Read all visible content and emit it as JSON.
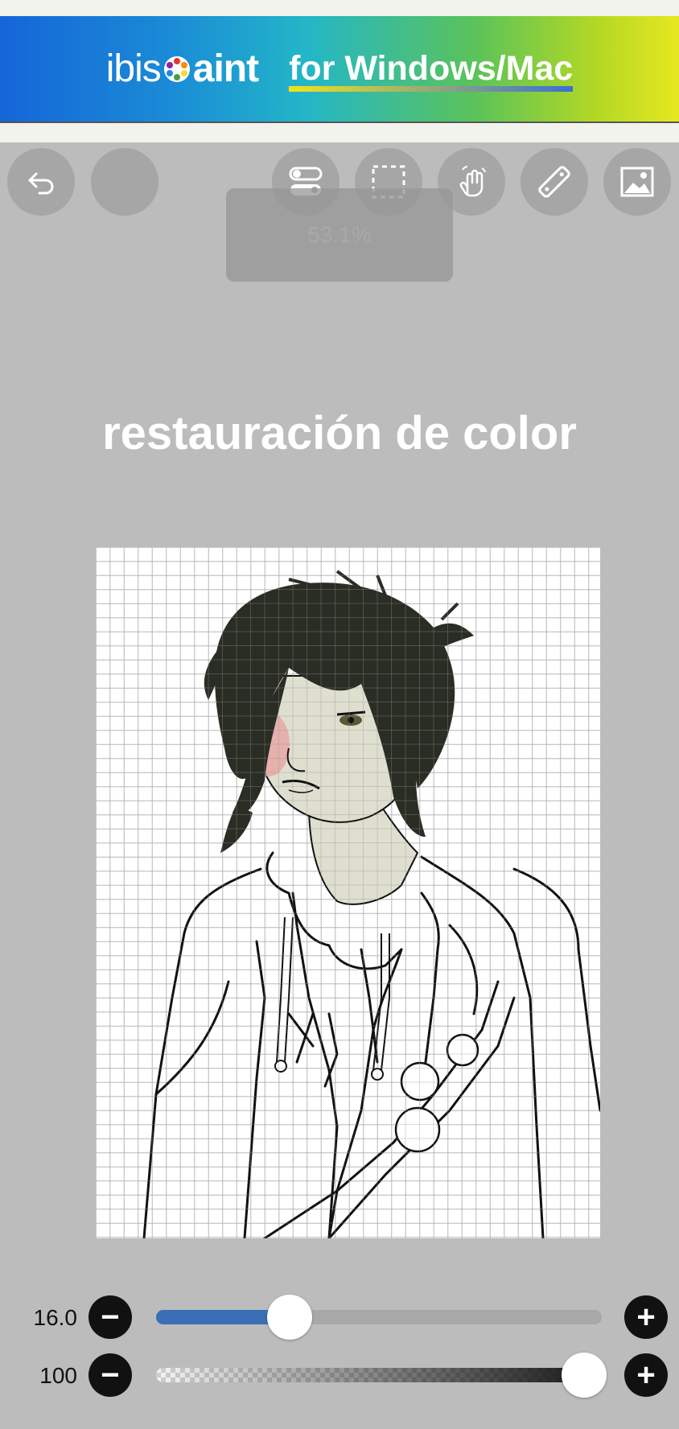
{
  "banner": {
    "brand_prefix": "ibis",
    "brand_suffix": "aint",
    "tagline": "for Windows/Mac",
    "colors": {
      "start": "#1565d8",
      "end": "#e6e81f"
    }
  },
  "toolbar": {
    "buttons": [
      "undo-icon",
      "blank-icon",
      "toggle-icon",
      "selection-icon",
      "hand-icon",
      "ruler-icon",
      "image-icon"
    ]
  },
  "zoom": {
    "label": "53.1%"
  },
  "overlay": {
    "heading": "restauración de color"
  },
  "brush": {
    "size": {
      "label": "16.0",
      "value": 16.0,
      "fraction": 0.3
    },
    "opacity": {
      "label": "100",
      "value": 100,
      "fraction": 1.0
    }
  },
  "colors": {
    "accent": "#3a6fb6",
    "hair": "#2a2d24",
    "skin": "#dedfcf",
    "blush": "#e8a0a0"
  }
}
